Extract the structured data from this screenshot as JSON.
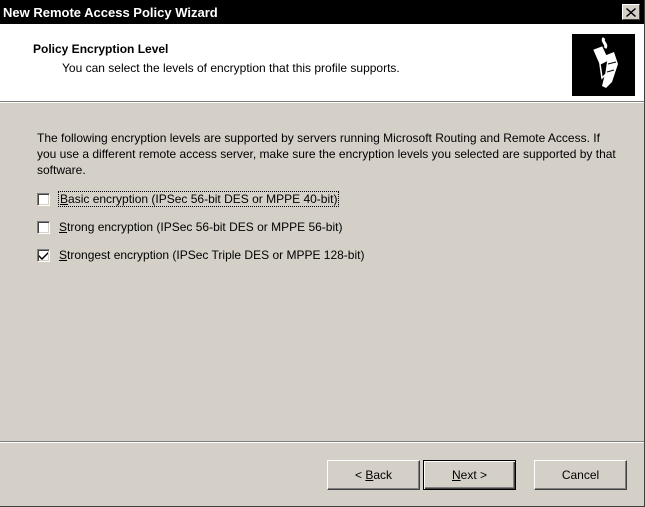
{
  "window": {
    "title": "New Remote Access Policy Wizard"
  },
  "header": {
    "title": "Policy Encryption Level",
    "subtitle": "You can select the levels of encryption that this profile supports."
  },
  "content": {
    "description": "The following encryption levels are supported by servers running Microsoft Routing and Remote Access. If you use a different remote access server, make sure the encryption levels you selected are supported by that software.",
    "options": [
      {
        "mnemonic": "B",
        "rest": "asic encryption (IPSec 56-bit DES or MPPE 40-bit)",
        "checked": false
      },
      {
        "mnemonic": "S",
        "rest": "trong encryption (IPSec 56-bit DES or MPPE 56-bit)",
        "checked": false
      },
      {
        "mnemonic": "S",
        "rest": "trongest encryption (IPSec Triple DES or MPPE 128-bit)",
        "checked": true
      }
    ]
  },
  "buttons": {
    "back_prefix": "< ",
    "back_mnemonic": "B",
    "back_rest": "ack",
    "next_mnemonic": "N",
    "next_rest": "ext >",
    "cancel": "Cancel"
  },
  "icons": {
    "close": "close-icon",
    "wizard_logo": "connection-plug-icon",
    "check": "checkmark-icon"
  },
  "colors": {
    "titlebar": "#000000",
    "face": "#d4d0c8",
    "header_bg": "#ffffff"
  }
}
